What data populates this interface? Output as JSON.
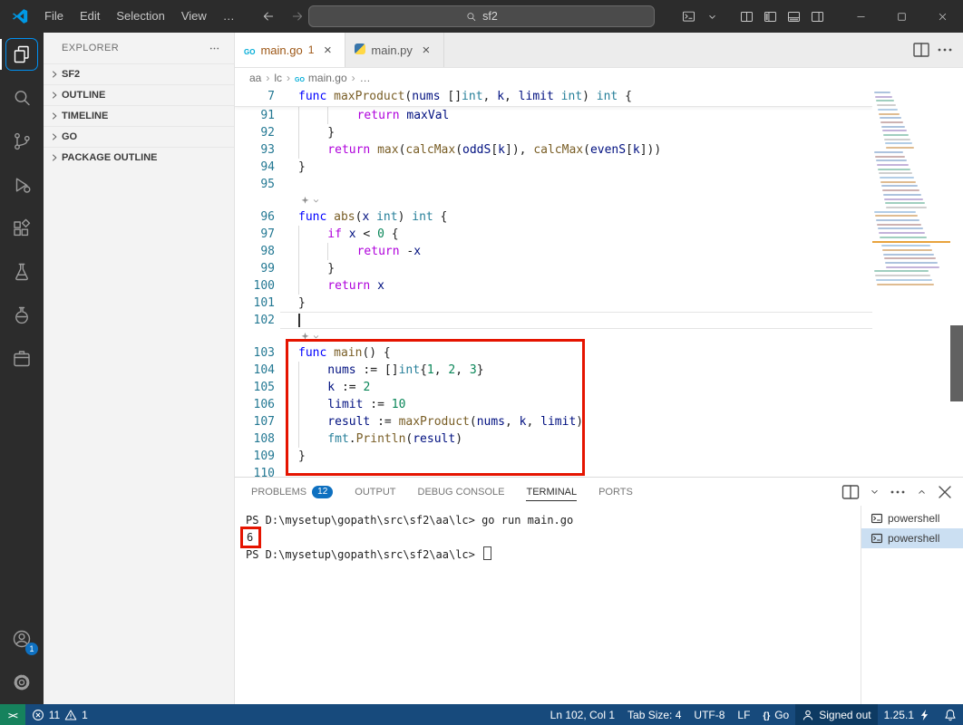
{
  "title_bar": {
    "menus": [
      "File",
      "Edit",
      "Selection",
      "View",
      "…"
    ],
    "search_value": "sf2"
  },
  "activity_bar": {
    "items": [
      {
        "name": "explorer",
        "icon": "files-icon",
        "active": true
      },
      {
        "name": "search",
        "icon": "search-icon"
      },
      {
        "name": "source-control",
        "icon": "source-control-icon"
      },
      {
        "name": "run-debug",
        "icon": "run-debug-icon"
      },
      {
        "name": "extensions",
        "icon": "extensions-icon"
      },
      {
        "name": "testing",
        "icon": "beaker-icon"
      },
      {
        "name": "extension-flask",
        "icon": "flask-icon"
      },
      {
        "name": "extension-box",
        "icon": "box-icon"
      }
    ],
    "bottom": [
      {
        "name": "accounts",
        "icon": "account-icon",
        "badge": "1"
      },
      {
        "name": "settings",
        "icon": "gear-icon"
      }
    ]
  },
  "sidebar": {
    "header": "EXPLORER",
    "sections": [
      {
        "label": "SF2"
      },
      {
        "label": "OUTLINE"
      },
      {
        "label": "TIMELINE"
      },
      {
        "label": "GO"
      },
      {
        "label": "PACKAGE OUTLINE"
      }
    ]
  },
  "editor": {
    "tabs": [
      {
        "label": "main.go",
        "icon": "go-file-icon",
        "badge": "1",
        "active": true,
        "modified": true
      },
      {
        "label": "main.py",
        "icon": "python-file-icon",
        "active": false
      }
    ],
    "breadcrumbs": [
      {
        "label": "aa"
      },
      {
        "label": "lc"
      },
      {
        "label": "main.go",
        "icon": "go"
      },
      {
        "label": "…"
      }
    ],
    "sticky": {
      "number": "7",
      "tokens": [
        [
          "kw",
          "func"
        ],
        [
          "pl",
          " "
        ],
        [
          "fn",
          "maxProduct"
        ],
        [
          "pl",
          "("
        ],
        [
          "var",
          "nums"
        ],
        [
          "pl",
          " []"
        ],
        [
          "type",
          "int"
        ],
        [
          "pl",
          ", "
        ],
        [
          "var",
          "k"
        ],
        [
          "pl",
          ", "
        ],
        [
          "var",
          "limit"
        ],
        [
          "pl",
          " "
        ],
        [
          "type",
          "int"
        ],
        [
          "pl",
          ") "
        ],
        [
          "type",
          "int"
        ],
        [
          "pl",
          " {"
        ]
      ]
    },
    "lines": [
      {
        "n": 91,
        "ind": 2,
        "t": [
          [
            "ctrl",
            "return"
          ],
          [
            "pl",
            " "
          ],
          [
            "var",
            "maxVal"
          ]
        ]
      },
      {
        "n": 92,
        "ind": 1,
        "t": [
          [
            "pl",
            "}"
          ]
        ]
      },
      {
        "n": 93,
        "ind": 1,
        "t": [
          [
            "ctrl",
            "return"
          ],
          [
            "pl",
            " "
          ],
          [
            "fn",
            "max"
          ],
          [
            "pl",
            "("
          ],
          [
            "fn",
            "calcMax"
          ],
          [
            "pl",
            "("
          ],
          [
            "var",
            "oddS"
          ],
          [
            "pl",
            "["
          ],
          [
            "var",
            "k"
          ],
          [
            "pl",
            "]), "
          ],
          [
            "fn",
            "calcMax"
          ],
          [
            "pl",
            "("
          ],
          [
            "var",
            "evenS"
          ],
          [
            "pl",
            "["
          ],
          [
            "var",
            "k"
          ],
          [
            "pl",
            "]))"
          ]
        ]
      },
      {
        "n": 94,
        "ind": 0,
        "t": [
          [
            "pl",
            "}"
          ]
        ]
      },
      {
        "n": 95,
        "ind": 0,
        "t": []
      },
      {
        "lens": true
      },
      {
        "n": 96,
        "ind": 0,
        "t": [
          [
            "kw",
            "func"
          ],
          [
            "pl",
            " "
          ],
          [
            "fn",
            "abs"
          ],
          [
            "pl",
            "("
          ],
          [
            "var",
            "x"
          ],
          [
            "pl",
            " "
          ],
          [
            "type",
            "int"
          ],
          [
            "pl",
            ") "
          ],
          [
            "type",
            "int"
          ],
          [
            "pl",
            " {"
          ]
        ]
      },
      {
        "n": 97,
        "ind": 1,
        "t": [
          [
            "ctrl",
            "if"
          ],
          [
            "pl",
            " "
          ],
          [
            "var",
            "x"
          ],
          [
            "pl",
            " < "
          ],
          [
            "num",
            "0"
          ],
          [
            "pl",
            " {"
          ]
        ]
      },
      {
        "n": 98,
        "ind": 2,
        "t": [
          [
            "ctrl",
            "return"
          ],
          [
            "pl",
            " -"
          ],
          [
            "var",
            "x"
          ]
        ]
      },
      {
        "n": 99,
        "ind": 1,
        "t": [
          [
            "pl",
            "}"
          ]
        ]
      },
      {
        "n": 100,
        "ind": 1,
        "t": [
          [
            "ctrl",
            "return"
          ],
          [
            "pl",
            " "
          ],
          [
            "var",
            "x"
          ]
        ]
      },
      {
        "n": 101,
        "ind": 0,
        "t": [
          [
            "pl",
            "}"
          ]
        ]
      },
      {
        "n": 102,
        "ind": 0,
        "t": [],
        "cursor": true,
        "current": true
      },
      {
        "lens": true
      },
      {
        "n": 103,
        "ind": 0,
        "t": [
          [
            "kw",
            "func"
          ],
          [
            "pl",
            " "
          ],
          [
            "fn",
            "main"
          ],
          [
            "pl",
            "() {"
          ]
        ]
      },
      {
        "n": 104,
        "ind": 1,
        "t": [
          [
            "var",
            "nums"
          ],
          [
            "pl",
            " := []"
          ],
          [
            "type",
            "int"
          ],
          [
            "pl",
            "{"
          ],
          [
            "num",
            "1"
          ],
          [
            "pl",
            ", "
          ],
          [
            "num",
            "2"
          ],
          [
            "pl",
            ", "
          ],
          [
            "num",
            "3"
          ],
          [
            "pl",
            "}"
          ]
        ]
      },
      {
        "n": 105,
        "ind": 1,
        "t": [
          [
            "var",
            "k"
          ],
          [
            "pl",
            " := "
          ],
          [
            "num",
            "2"
          ]
        ]
      },
      {
        "n": 106,
        "ind": 1,
        "t": [
          [
            "var",
            "limit"
          ],
          [
            "pl",
            " := "
          ],
          [
            "num",
            "10"
          ]
        ]
      },
      {
        "n": 107,
        "ind": 1,
        "t": [
          [
            "var",
            "result"
          ],
          [
            "pl",
            " := "
          ],
          [
            "fn",
            "maxProduct"
          ],
          [
            "pl",
            "("
          ],
          [
            "var",
            "nums"
          ],
          [
            "pl",
            ", "
          ],
          [
            "var",
            "k"
          ],
          [
            "pl",
            ", "
          ],
          [
            "var",
            "limit"
          ],
          [
            "pl",
            ")"
          ]
        ]
      },
      {
        "n": 108,
        "ind": 1,
        "t": [
          [
            "type",
            "fmt"
          ],
          [
            "pl",
            "."
          ],
          [
            "fn",
            "Println"
          ],
          [
            "pl",
            "("
          ],
          [
            "var",
            "result"
          ],
          [
            "pl",
            ")"
          ]
        ]
      },
      {
        "n": 109,
        "ind": 0,
        "t": [
          [
            "pl",
            "}"
          ]
        ]
      },
      {
        "n": 110,
        "ind": 0,
        "t": []
      }
    ]
  },
  "panel": {
    "tabs": [
      {
        "label": "PROBLEMS",
        "badge": "12"
      },
      {
        "label": "OUTPUT"
      },
      {
        "label": "DEBUG CONSOLE"
      },
      {
        "label": "TERMINAL",
        "active": true
      },
      {
        "label": "PORTS"
      }
    ],
    "terminal": {
      "lines": [
        {
          "text": "PS D:\\mysetup\\gopath\\src\\sf2\\aa\\lc> go run main.go"
        },
        {
          "text": "6",
          "annotated": true
        },
        {
          "text": "PS D:\\mysetup\\gopath\\src\\sf2\\aa\\lc> ",
          "cursor": true
        }
      ],
      "list": [
        {
          "label": "powershell",
          "selected": false
        },
        {
          "label": "powershell",
          "selected": true
        }
      ]
    }
  },
  "status_bar": {
    "left": [
      {
        "name": "remote-indicator",
        "chip": "green",
        "parts": [
          {
            "icon": "remote-icon"
          }
        ]
      },
      {
        "name": "problems-status",
        "parts": [
          {
            "icon": "error-icon"
          },
          {
            "text": "11"
          },
          {
            "icon": "warning-icon"
          },
          {
            "text": "1"
          }
        ]
      }
    ],
    "right": [
      {
        "name": "cursor-position",
        "parts": [
          {
            "text": "Ln 102, Col 1"
          }
        ]
      },
      {
        "name": "tab-size",
        "parts": [
          {
            "text": "Tab Size: 4"
          }
        ]
      },
      {
        "name": "encoding",
        "parts": [
          {
            "text": "UTF-8"
          }
        ]
      },
      {
        "name": "eol",
        "parts": [
          {
            "text": "LF"
          }
        ]
      },
      {
        "name": "language-mode",
        "parts": [
          {
            "icon": "braces-icon"
          },
          {
            "text": "Go"
          }
        ]
      },
      {
        "name": "accounts-status",
        "chip": "dark",
        "parts": [
          {
            "icon": "person-icon"
          },
          {
            "text": "Signed out"
          }
        ]
      },
      {
        "name": "go-version",
        "parts": [
          {
            "text": "1.25.1"
          },
          {
            "icon": "bolt-icon"
          }
        ]
      },
      {
        "name": "notifications-bell",
        "parts": [
          {
            "icon": "bell-icon"
          }
        ]
      }
    ]
  }
}
